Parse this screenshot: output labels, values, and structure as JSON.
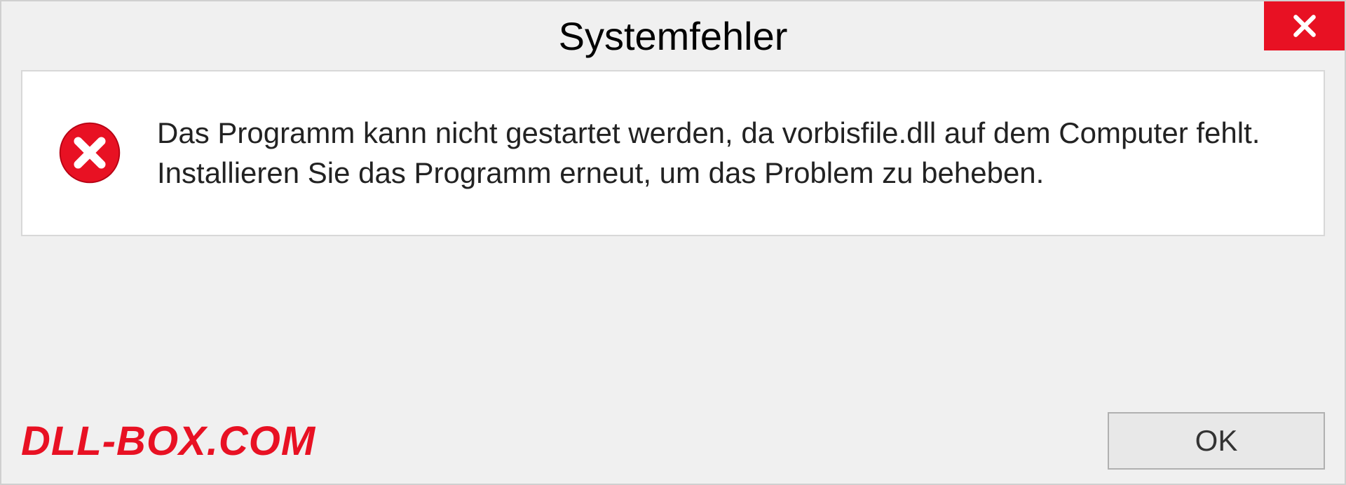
{
  "dialog": {
    "title": "Systemfehler",
    "message": "Das Programm kann nicht gestartet werden, da vorbisfile.dll auf dem Computer fehlt. Installieren Sie das Programm erneut, um das Problem zu beheben.",
    "ok_button_label": "OK"
  },
  "watermark": {
    "text": "DLL-BOX.COM"
  },
  "colors": {
    "error_red": "#e81123",
    "dialog_bg": "#f0f0f0",
    "panel_bg": "#ffffff"
  }
}
